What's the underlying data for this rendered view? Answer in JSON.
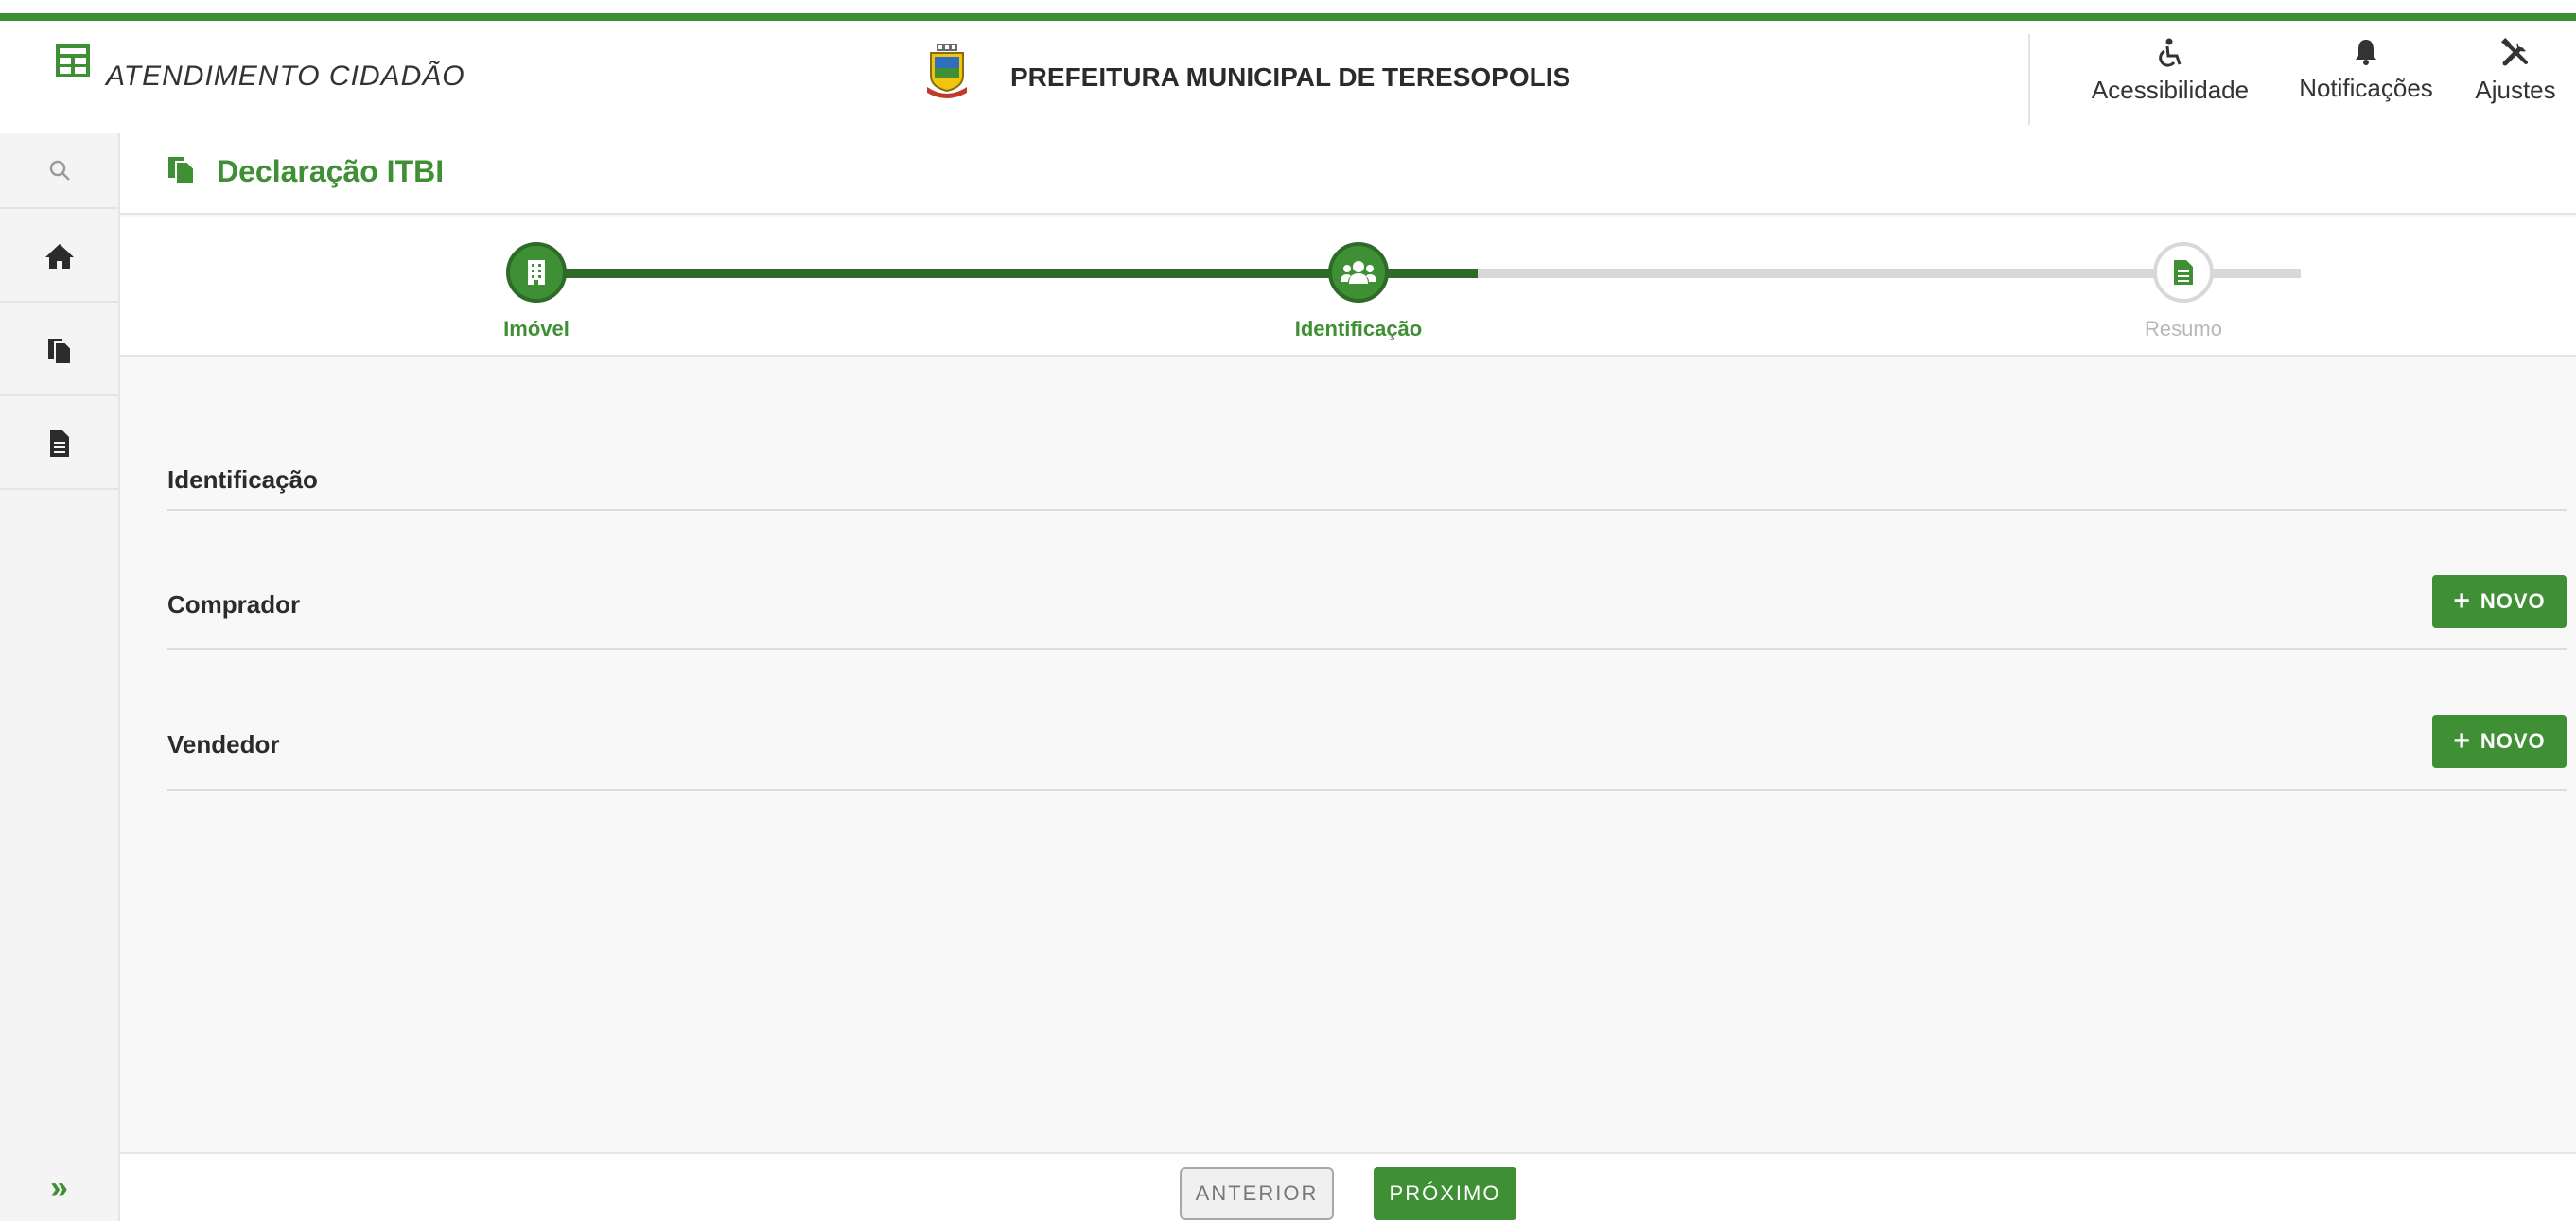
{
  "header": {
    "app_title": "ATENDIMENTO CIDADÃO",
    "brand_title": "PREFEITURA MUNICIPAL DE TERESOPOLIS",
    "actions": {
      "accessibility": "Acessibilidade",
      "notifications": "Notificações",
      "settings": "Ajustes"
    }
  },
  "page": {
    "title": "Declaração ITBI"
  },
  "stepper": {
    "steps": [
      {
        "label": "Imóvel",
        "state": "completed",
        "icon": "building-icon"
      },
      {
        "label": "Identificação",
        "state": "active",
        "icon": "users-icon"
      },
      {
        "label": "Resumo",
        "state": "pending",
        "icon": "document-icon"
      }
    ]
  },
  "sections": {
    "identification": {
      "title": "Identificação"
    },
    "buyer": {
      "title": "Comprador",
      "button": "NOVO"
    },
    "seller": {
      "title": "Vendedor",
      "button": "NOVO"
    }
  },
  "footer": {
    "previous": "ANTERIOR",
    "next": "PRÓXIMO"
  },
  "colors": {
    "brand_green": "#3f8f35",
    "dark_green": "#2e6b28",
    "inactive_gray": "#d8d8d8"
  }
}
